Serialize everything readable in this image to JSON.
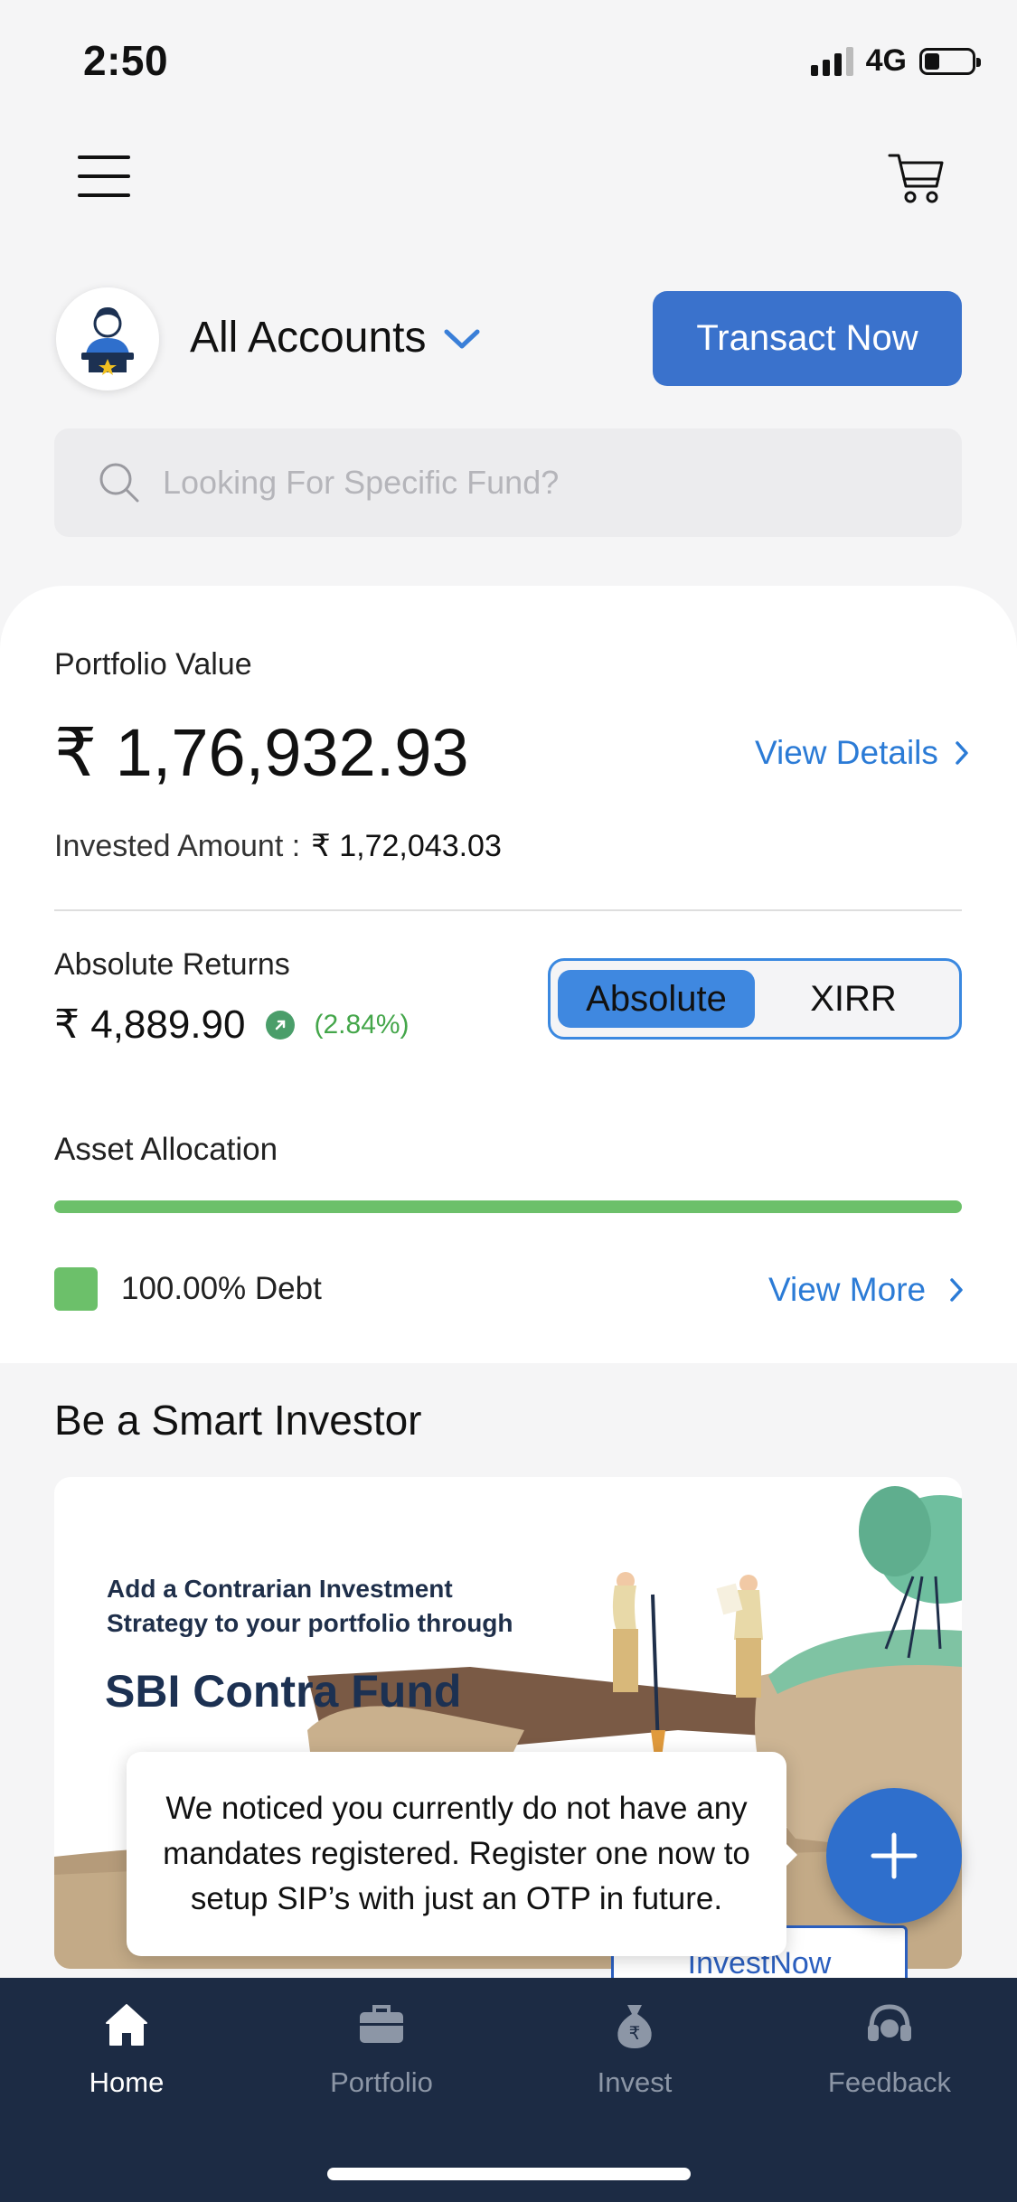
{
  "status_bar": {
    "time": "2:50",
    "network": "4G"
  },
  "header": {
    "menu_icon": "hamburger-menu-icon",
    "cart_icon": "cart-icon"
  },
  "account": {
    "selector_label": "All Accounts",
    "transact_button": "Transact Now"
  },
  "search": {
    "placeholder": "Looking For Specific Fund?"
  },
  "portfolio": {
    "value_label": "Portfolio Value",
    "value": "₹ 1,76,932.93",
    "view_details": "View Details",
    "invested_label": "Invested Amount :",
    "invested_value": "₹ 1,72,043.03",
    "returns_label": "Absolute Returns",
    "returns_value": "₹ 4,889.90",
    "returns_pct": "(2.84%)",
    "toggle_options": [
      "Absolute",
      "XIRR"
    ],
    "toggle_selected": "Absolute"
  },
  "asset_allocation": {
    "label": "Asset Allocation",
    "debt_fraction": 1.0,
    "legend": "100.00% Debt",
    "view_more": "View More",
    "color": "#6cc06a"
  },
  "smart_investor": {
    "title": "Be a Smart Investor",
    "banner_line1": "Add a Contrarian Investment",
    "banner_line2": "Strategy to your portfolio through",
    "banner_title": "SBI Contra Fund",
    "banner_button": "InvestNow"
  },
  "tooltip": {
    "text": "We noticed you currently do not have any mandates registered. Register one now to setup SIP’s with just an OTP in future."
  },
  "bottom_nav": {
    "home": "Home",
    "portfolio": "Portfolio",
    "invest": "Invest",
    "feedback": "Feedback"
  },
  "colors": {
    "accent": "#3a72cc",
    "link": "#2b7bd6",
    "positive": "#44a64a",
    "nav_bg": "#1c2b44"
  }
}
